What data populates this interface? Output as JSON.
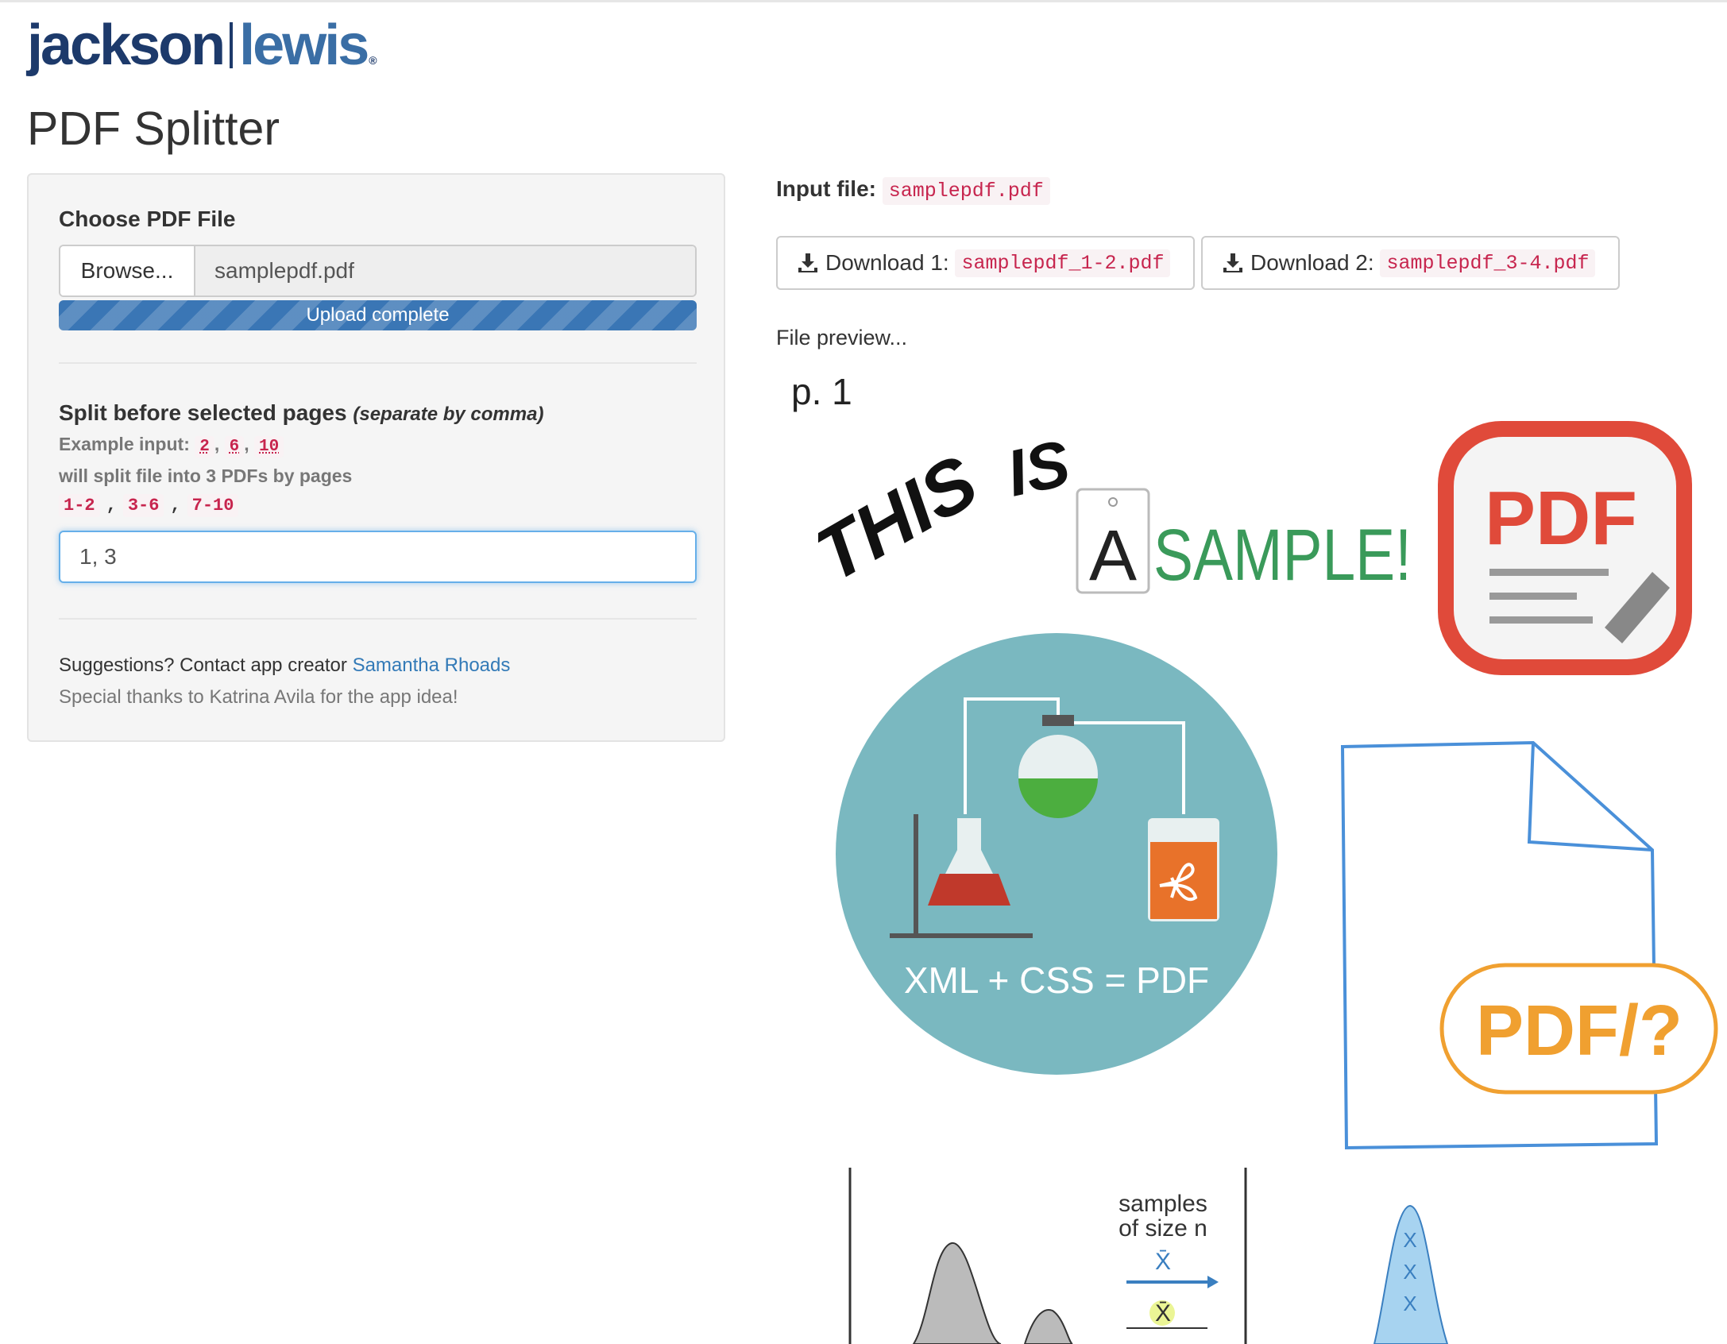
{
  "logo": {
    "word1": "jackson",
    "word2": "lewis",
    "reg": "®"
  },
  "page": {
    "title": "PDF Splitter"
  },
  "sidebar": {
    "choose_label": "Choose PDF File",
    "browse_label": "Browse...",
    "filename": "samplepdf.pdf",
    "progress_label": "Upload complete",
    "progress_fraction": 1.0,
    "split_label": "Split before selected pages",
    "split_hint": "(separate by comma)",
    "example_prefix": "Example input:",
    "example_values": [
      "2",
      "6",
      "10"
    ],
    "split_result_text": "will split file into 3 PDFs by pages",
    "split_ranges": [
      "1-2",
      "3-6",
      "7-10"
    ],
    "split_input_value": "1, 3",
    "suggestion_text": "Suggestions? Contact app creator",
    "creator_name": "Samantha Rhoads",
    "thanks_text": "Special thanks to Katrina Avila for the app idea!"
  },
  "main": {
    "input_file_label": "Input file:",
    "input_file_name": "samplepdf.pdf",
    "downloads": [
      {
        "label": "Download 1:",
        "file": "samplepdf_1-2.pdf"
      },
      {
        "label": "Download 2:",
        "file": "samplepdf_3-4.pdf"
      }
    ],
    "preview_label": "File preview...",
    "page_number": "p. 1"
  },
  "preview": {
    "this_is_text": [
      "THIS",
      "IS"
    ],
    "sample_letter": "A",
    "sample_text": "SAMPLE!",
    "pdf_icon_text": "PDF",
    "circle_caption": "XML + CSS = PDF",
    "doc_badge": "PDF/?",
    "stats_text_line1": "samples",
    "stats_text_line2": "of size n",
    "stats_xbar": "X̄",
    "stats_x": "X",
    "colors": {
      "accent_red": "#e04a3a",
      "teal": "#7ab8c0",
      "orange": "#f0a030",
      "doc_blue": "#4a90d9"
    }
  }
}
